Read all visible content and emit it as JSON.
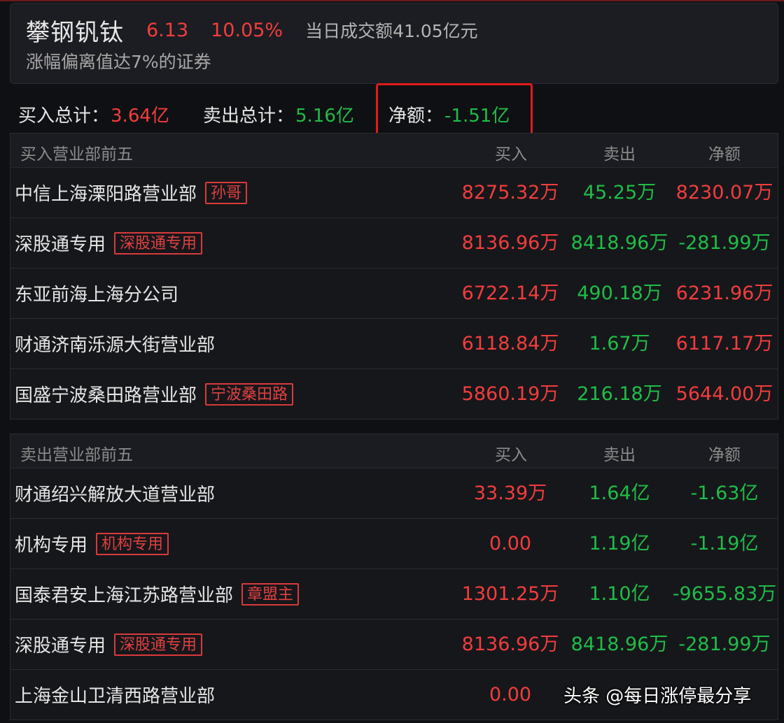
{
  "header": {
    "stock_name": "攀钢钒钛",
    "price": "6.13",
    "change_pct": "10.05%",
    "turnover": "当日成交额41.05亿元",
    "reason": "涨幅偏离值达7%的证券"
  },
  "totals": {
    "buy_label": "买入总计：",
    "buy_value": "3.64亿",
    "sell_label": "卖出总计：",
    "sell_value": "5.16亿",
    "net_label": "净额：",
    "net_value": "-1.51亿"
  },
  "buy_table": {
    "title": "买入营业部前五",
    "col_buy": "买入",
    "col_sell": "卖出",
    "col_net": "净额",
    "rows": [
      {
        "name": "中信上海溧阳路营业部",
        "tag": "孙哥",
        "buy": "8275.32万",
        "sell": "45.25万",
        "net": "8230.07万"
      },
      {
        "name": "深股通专用",
        "tag": "深股通专用",
        "buy": "8136.96万",
        "sell": "8418.96万",
        "net": "-281.99万"
      },
      {
        "name": "东亚前海上海分公司",
        "tag": "",
        "buy": "6722.14万",
        "sell": "490.18万",
        "net": "6231.96万"
      },
      {
        "name": "财通济南泺源大街营业部",
        "tag": "",
        "buy": "6118.84万",
        "sell": "1.67万",
        "net": "6117.17万"
      },
      {
        "name": "国盛宁波桑田路营业部",
        "tag": "宁波桑田路",
        "buy": "5860.19万",
        "sell": "216.18万",
        "net": "5644.00万"
      }
    ]
  },
  "sell_table": {
    "title": "卖出营业部前五",
    "col_buy": "买入",
    "col_sell": "卖出",
    "col_net": "净额",
    "rows": [
      {
        "name": "财通绍兴解放大道营业部",
        "tag": "",
        "buy": "33.39万",
        "sell": "1.64亿",
        "net": "-1.63亿"
      },
      {
        "name": "机构专用",
        "tag": "机构专用",
        "buy": "0.00",
        "sell": "1.19亿",
        "net": "-1.19亿"
      },
      {
        "name": "国泰君安上海江苏路营业部",
        "tag": "章盟主",
        "buy": "1301.25万",
        "sell": "1.10亿",
        "net": "-9655.83万"
      },
      {
        "name": "深股通专用",
        "tag": "深股通专用",
        "buy": "8136.96万",
        "sell": "8418.96万",
        "net": "-281.99万"
      },
      {
        "name": "上海金山卫清西路营业部",
        "tag": "",
        "buy": "0.00",
        "sell": "",
        "net": ""
      }
    ]
  },
  "watermark": "头条 @每日涨停最分享",
  "colors": {
    "up": "#f23d3d",
    "down": "#1fbd47",
    "highlight_box": "#e01b1b"
  }
}
